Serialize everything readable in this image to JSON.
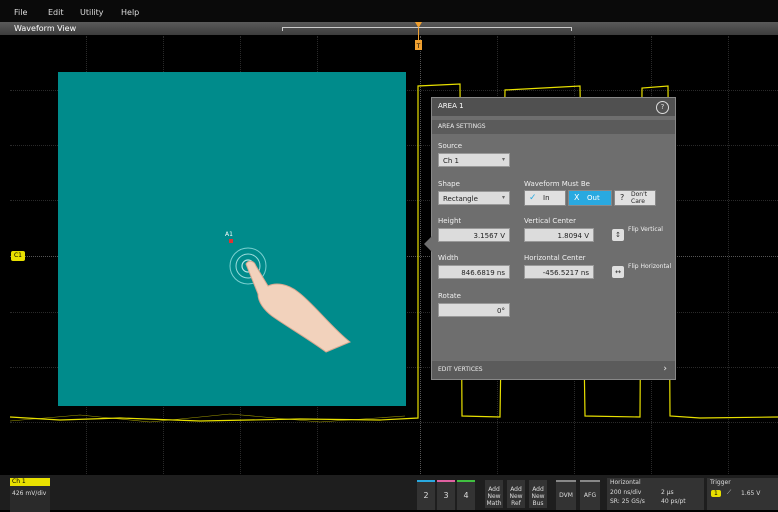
{
  "menu": [
    "File",
    "Edit",
    "Utility",
    "Help"
  ],
  "view_title": "Waveform View",
  "trigger_marker": "T",
  "channel_marker": "C1",
  "overlay": {
    "area_label": "A1"
  },
  "panel": {
    "title": "AREA 1",
    "help": "?",
    "section": "AREA SETTINGS",
    "source_label": "Source",
    "source_value": "Ch 1",
    "shape_label": "Shape",
    "shape_value": "Rectangle",
    "must_label": "Waveform Must Be",
    "must_in": "In",
    "must_out": "Out",
    "must_dontcare": "Don't Care",
    "height_label": "Height",
    "height_value": "3.1567 V",
    "vcenter_label": "Vertical Center",
    "vcenter_value": "1.8094 V",
    "flip_vertical": "Flip Vertical",
    "width_label": "Width",
    "width_value": "846.6819 ns",
    "hcenter_label": "Horizontal Center",
    "hcenter_value": "-456.5217 ns",
    "flip_horizontal": "Flip Horizontal",
    "rotate_label": "Rotate",
    "rotate_value": "0°",
    "footer": "EDIT VERTICES",
    "footer_arrow": "›"
  },
  "bottom": {
    "ch1_title": "Ch 1",
    "ch1_scale": "426 mV/div",
    "channels": [
      "2",
      "3",
      "4"
    ],
    "add_buttons": [
      {
        "l1": "Add",
        "l2": "New",
        "l3": "Math"
      },
      {
        "l1": "Add",
        "l2": "New",
        "l3": "Ref"
      },
      {
        "l1": "Add",
        "l2": "New",
        "l3": "Bus"
      }
    ],
    "dvm": "DVM",
    "afg": "AFG",
    "horizontal_title": "Horizontal",
    "hdiv": "200 ns/div",
    "hspan": "2 µs",
    "sample_rate": "SR: 25 GS/s",
    "pt": "40 ps/pt",
    "trigger_title": "Trigger",
    "trigger_ch": "1",
    "trigger_level": "1.65 V"
  },
  "colors": {
    "teal": "#008b8b",
    "trace": "#e8e000",
    "panel": "#6e6e6e",
    "out_active": "#29a9e0"
  }
}
